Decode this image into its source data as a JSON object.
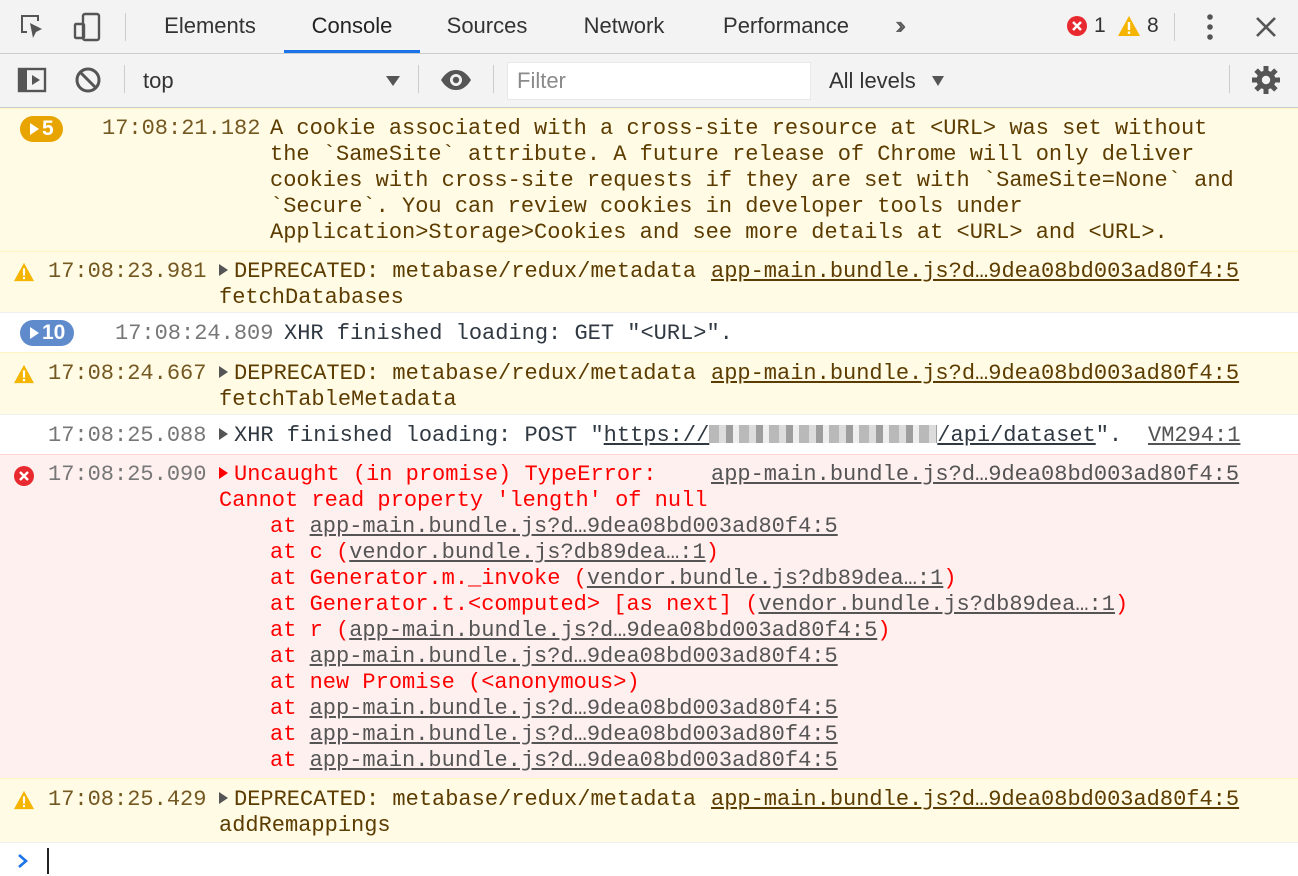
{
  "tabs": [
    "Elements",
    "Console",
    "Sources",
    "Network",
    "Performance"
  ],
  "active_tab": "Console",
  "counters": {
    "errors": "1",
    "warnings": "8"
  },
  "toolbar": {
    "context": "top",
    "filter_placeholder": "Filter",
    "levels": "All levels"
  },
  "messages": [
    {
      "type": "warning",
      "repeat": "5",
      "time": "17:08:21.182",
      "lines": [
        "A cookie associated with a cross-site resource at <URL> was set without",
        "the `SameSite` attribute. A future release of Chrome will only deliver",
        "cookies with cross-site requests if they are set with `SameSite=None` and",
        "`Secure`. You can review cookies in developer tools under",
        "Application>Storage>Cookies and see more details at <URL> and <URL>."
      ]
    },
    {
      "type": "warning",
      "time": "17:08:23.981",
      "text": "DEPRECATED: metabase/redux/metadata",
      "text2": "fetchDatabases",
      "source": "app-main.bundle.js?d…9dea08bd003ad80f4:5"
    },
    {
      "type": "info",
      "repeat": "10",
      "time": "17:08:24.809",
      "text": "XHR finished loading: GET \"<URL>\"."
    },
    {
      "type": "warning",
      "time": "17:08:24.667",
      "text": "DEPRECATED: metabase/redux/metadata",
      "text2": "fetchTableMetadata",
      "source": "app-main.bundle.js?d…9dea08bd003ad80f4:5"
    },
    {
      "type": "info",
      "time": "17:08:25.088",
      "text_prefix": "XHR finished loading: POST \"",
      "url_start": "https://",
      "url_end": "/api/dataset",
      "text_suffix": "\".",
      "source": "VM294:1"
    },
    {
      "type": "error",
      "time": "17:08:25.090",
      "text": "Uncaught (in promise) TypeError:",
      "text2": "Cannot read property 'length' of null",
      "source": "app-main.bundle.js?d…9dea08bd003ad80f4:5",
      "stack": [
        {
          "pre": "at ",
          "link": "app-main.bundle.js?d…9dea08bd003ad80f4:5",
          "post": ""
        },
        {
          "pre": "at c (",
          "link": "vendor.bundle.js?db89dea…:1",
          "post": ")"
        },
        {
          "pre": "at Generator.m._invoke (",
          "link": "vendor.bundle.js?db89dea…:1",
          "post": ")"
        },
        {
          "pre": "at Generator.t.<computed> [as next] (",
          "link": "vendor.bundle.js?db89dea…:1",
          "post": ")"
        },
        {
          "pre": "at r (",
          "link": "app-main.bundle.js?d…9dea08bd003ad80f4:5",
          "post": ")"
        },
        {
          "pre": "at ",
          "link": "app-main.bundle.js?d…9dea08bd003ad80f4:5",
          "post": ""
        },
        {
          "pre": "at new Promise (<anonymous>)",
          "link": "",
          "post": ""
        },
        {
          "pre": "at ",
          "link": "app-main.bundle.js?d…9dea08bd003ad80f4:5",
          "post": ""
        },
        {
          "pre": "at ",
          "link": "app-main.bundle.js?d…9dea08bd003ad80f4:5",
          "post": ""
        },
        {
          "pre": "at ",
          "link": "app-main.bundle.js?d…9dea08bd003ad80f4:5",
          "post": ""
        }
      ]
    },
    {
      "type": "warning",
      "time": "17:08:25.429",
      "text": "DEPRECATED: metabase/redux/metadata",
      "text2": "addRemappings",
      "source": "app-main.bundle.js?d…9dea08bd003ad80f4:5"
    }
  ],
  "colors": {
    "accent": "#1a73e8",
    "warning_bg": "#fffbe5",
    "warning_text": "#5c3c00",
    "error_bg": "#fff0f0",
    "error_text": "#ff0000",
    "error_badge": "#e8292f",
    "warning_badge": "#f4b400",
    "prompt": "#1a73e8"
  },
  "icons": [
    "inspect-element-icon",
    "device-toolbar-icon",
    "more-tabs-icon",
    "kebab-menu-icon",
    "close-icon",
    "sidebar-toggle-icon",
    "clear-console-icon",
    "eye-icon",
    "gear-icon",
    "warning-icon",
    "error-icon",
    "prompt-chevron-icon"
  ]
}
